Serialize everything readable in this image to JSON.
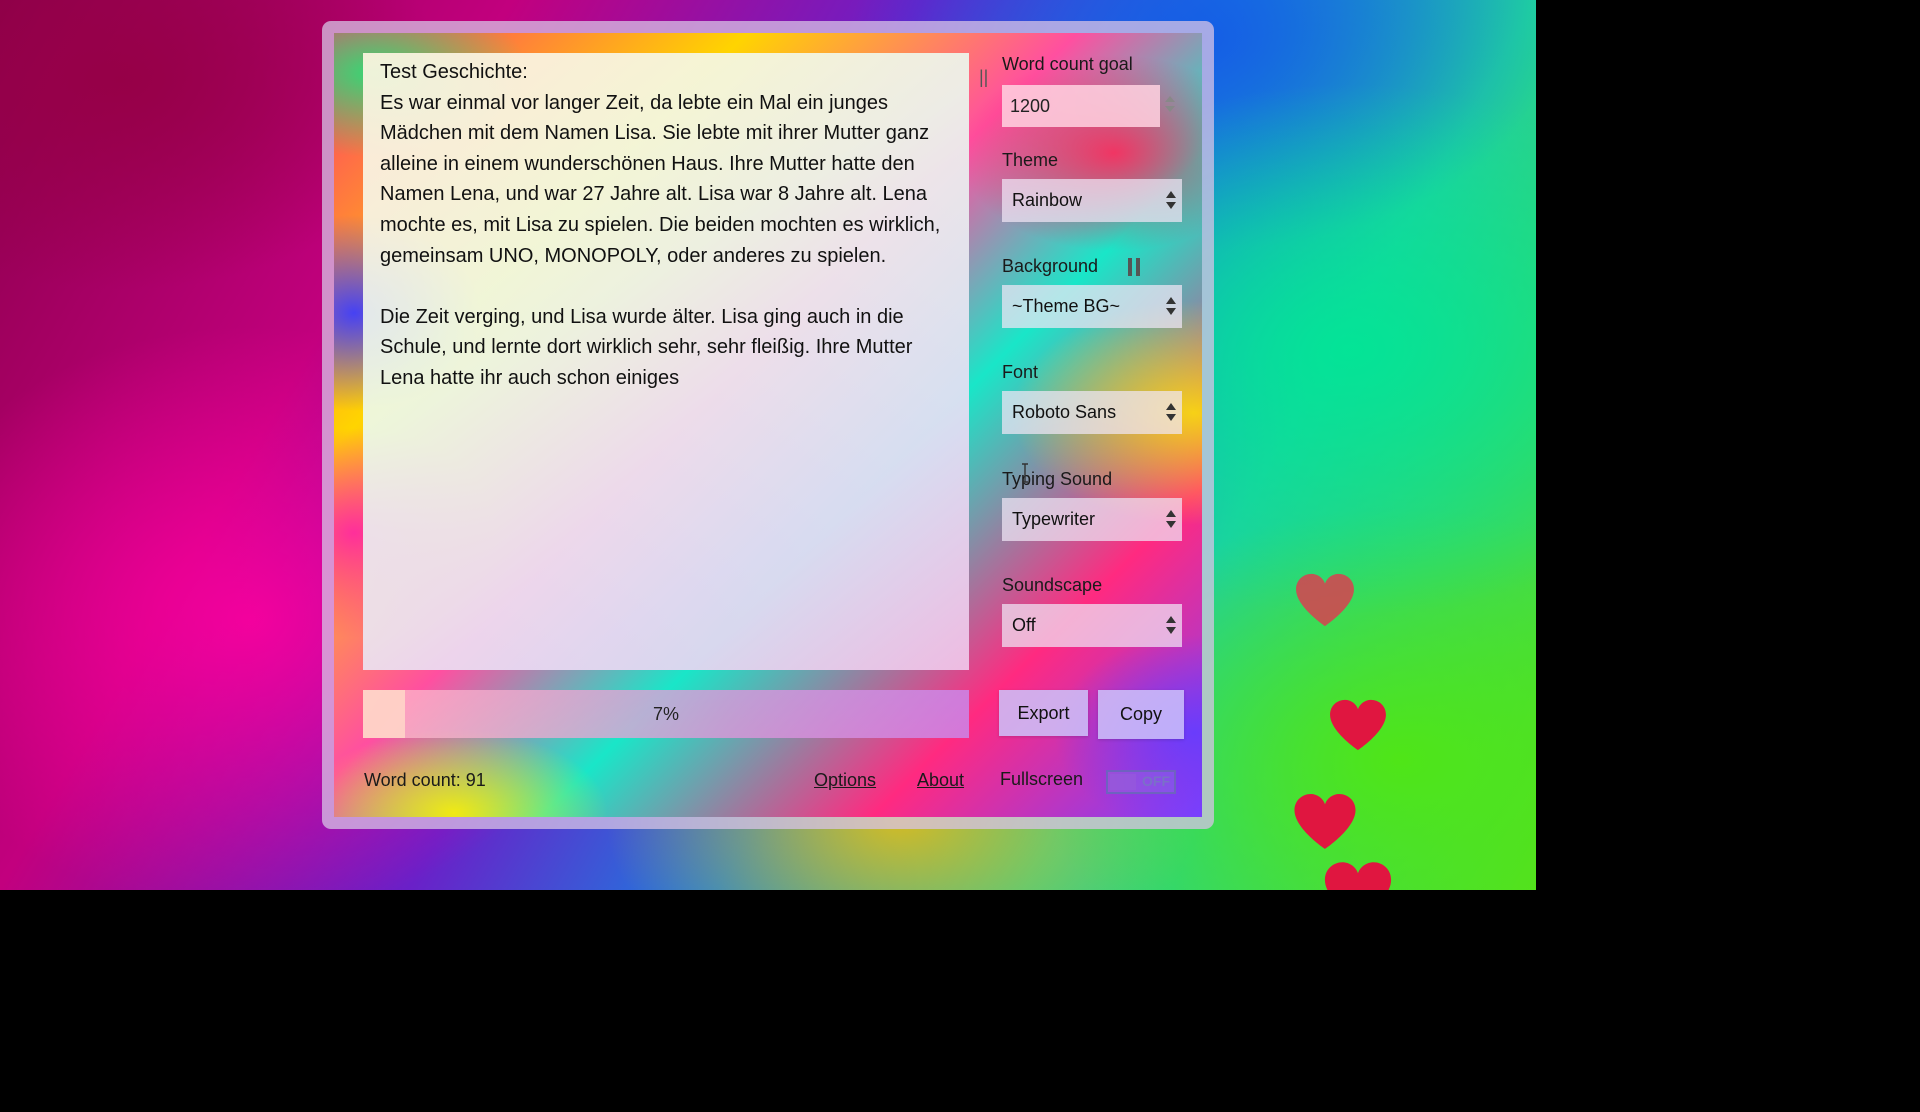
{
  "editor": {
    "text": "Test Geschichte:\nEs war einmal vor langer Zeit, da lebte ein Mal ein junges Mädchen mit dem Namen Lisa. Sie lebte mit ihrer Mutter ganz alleine in einem wunderschönen Haus. Ihre Mutter hatte den Namen Lena, und war 27 Jahre alt. Lisa war 8 Jahre alt. Lena mochte es, mit Lisa zu spielen. Die beiden mochten es wirklich, gemeinsam UNO, MONOPOLY, oder anderes zu spielen.\n\nDie Zeit verging, und Lisa wurde älter. Lisa ging auch in die Schule, und lernte dort wirklich sehr, sehr fleißig. Ihre Mutter Lena hatte ihr auch schon einiges",
    "resize_handle": "||"
  },
  "sidebar": {
    "word_goal_label": "Word count goal",
    "word_goal_value": "1200",
    "theme_label": "Theme",
    "theme_value": "Rainbow",
    "background_label": "Background",
    "background_value": "~Theme BG~",
    "font_label": "Font",
    "font_value": "Roboto Sans",
    "typing_sound_label": "Typing Sound",
    "typing_sound_value": "Typewriter",
    "soundscape_label": "Soundscape",
    "soundscape_value": "Off"
  },
  "progress": {
    "fraction": 0.07,
    "label": "7%"
  },
  "actions": {
    "export_label": "Export",
    "copy_label": "Copy"
  },
  "footer": {
    "word_count": "Word count: 91",
    "options_label": "Options",
    "about_label": "About",
    "fullscreen_label": "Fullscreen",
    "fullscreen_state": "OFF"
  },
  "colors": {
    "heart": "#e01640",
    "toggle_border": "#6f62c0"
  },
  "icons": [
    "pause-icon",
    "heart-icon",
    "select-arrows-icon",
    "stepper-icon",
    "text-cursor-icon"
  ]
}
